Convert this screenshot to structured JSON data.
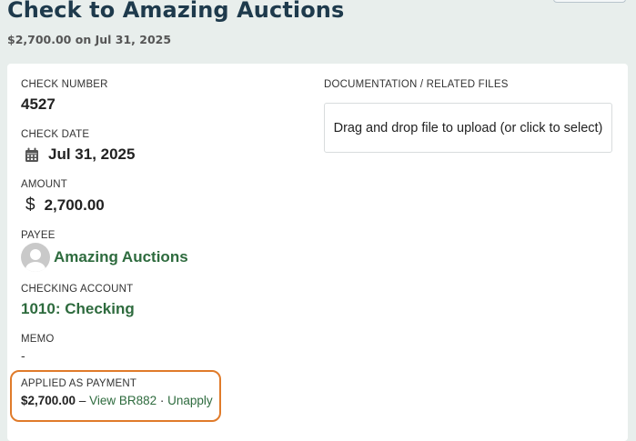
{
  "header": {
    "title": "Check to Amazing Auctions",
    "subtitle": "$2,700.00 on Jul 31, 2025"
  },
  "check": {
    "number_label": "CHECK NUMBER",
    "number": "4527",
    "date_label": "CHECK DATE",
    "date": "Jul 31, 2025",
    "amount_label": "AMOUNT",
    "amount_symbol": "$",
    "amount": "2,700.00",
    "payee_label": "PAYEE",
    "payee": "Amazing Auctions",
    "account_label": "CHECKING ACCOUNT",
    "account": "1010: Checking",
    "memo_label": "MEMO",
    "memo": "-"
  },
  "applied": {
    "label": "APPLIED AS PAYMENT",
    "amount": "$2,700.00",
    "separator": " – ",
    "view_link": "View BR882",
    "dot": " · ",
    "unapply_link": "Unapply"
  },
  "documents": {
    "label": "DOCUMENTATION / RELATED FILES",
    "dropzone_text": "Drag and drop file to upload (or click to select)"
  },
  "icons": {
    "date": "calendar-icon",
    "amount": "dollar-icon",
    "payee": "avatar-placeholder"
  },
  "colors": {
    "title": "#1e3a4c",
    "link_green": "#2e6b3e",
    "highlight_orange": "#e07b2a",
    "background": "#e8eeec"
  }
}
